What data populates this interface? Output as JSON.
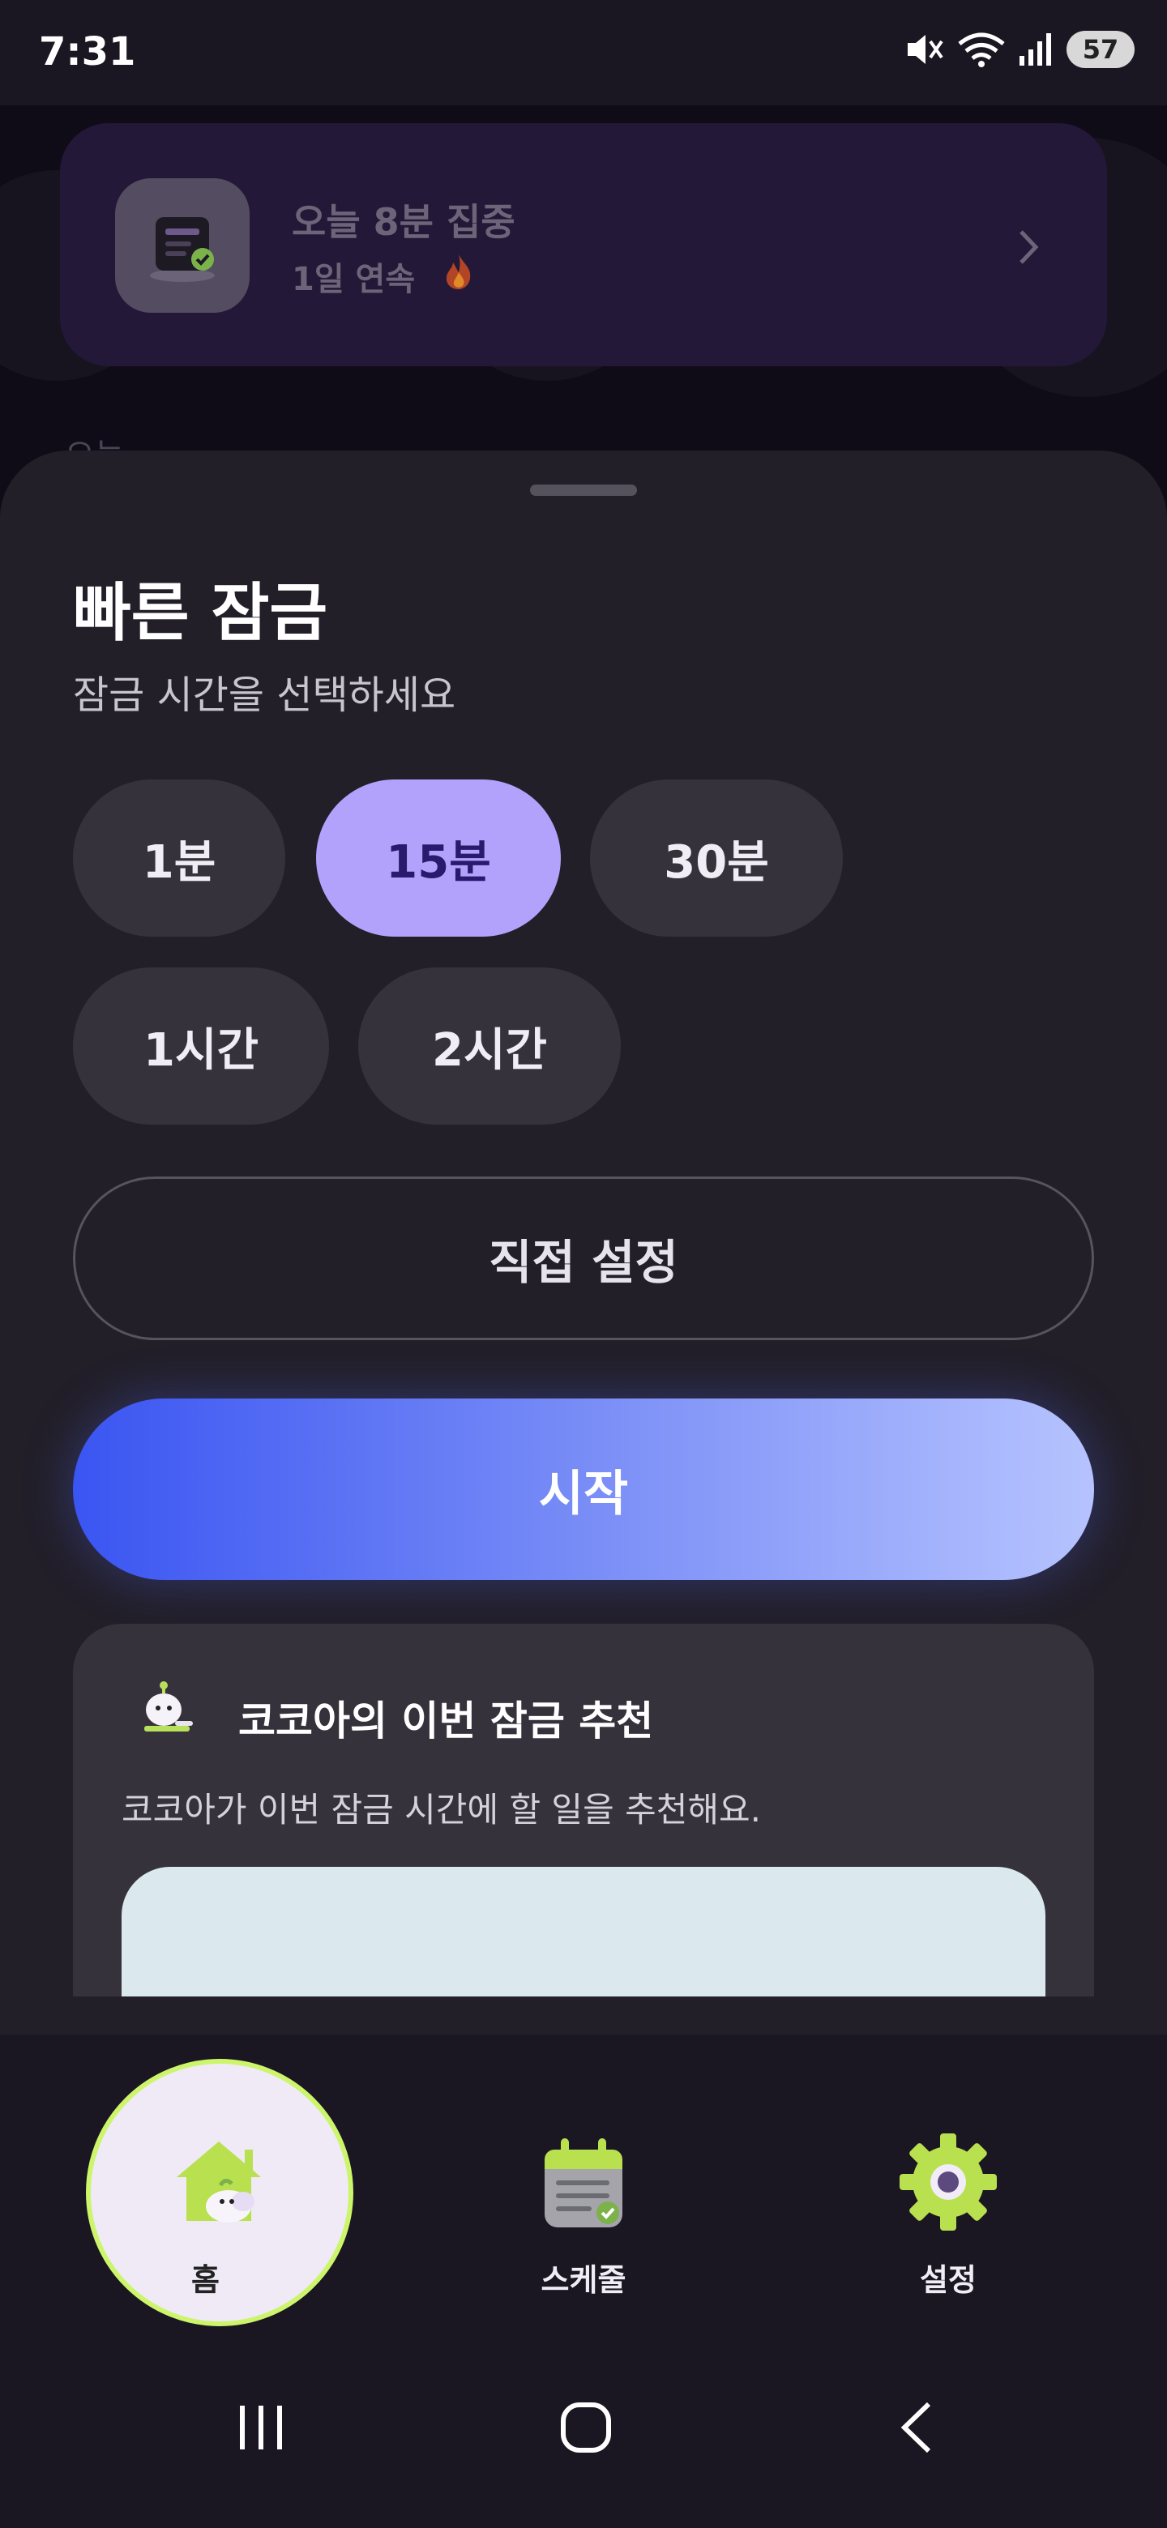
{
  "status_bar": {
    "time": "7:31",
    "battery": "57"
  },
  "background": {
    "focus_title": "오늘 8분 집중",
    "focus_streak": "1일 연속",
    "today_label": "오늘"
  },
  "quick_lock": {
    "title": "빠른 잠금",
    "subtitle": "잠금 시간을 선택하세요",
    "options": [
      {
        "label": "1분",
        "selected": false
      },
      {
        "label": "15분",
        "selected": true
      },
      {
        "label": "30분",
        "selected": false
      },
      {
        "label": "1시간",
        "selected": false
      },
      {
        "label": "2시간",
        "selected": false
      }
    ],
    "custom_label": "직접 설정",
    "start_label": "시작"
  },
  "recommendation": {
    "title": "코코아의 이번 잠금 추천",
    "description": "코코아가 이번 잠금 시간에 할 일을 추천해요."
  },
  "bottom_nav": {
    "items": [
      {
        "label": "홈",
        "icon": "home-icon",
        "active": true
      },
      {
        "label": "스케줄",
        "icon": "calendar-icon",
        "active": false
      },
      {
        "label": "설정",
        "icon": "gear-icon",
        "active": false
      }
    ]
  },
  "colors": {
    "accent_selected": "#b3a2fb",
    "start_gradient_start": "#3a55f2",
    "start_gradient_end": "#b6c3ff",
    "nav_highlight": "#cdf56b"
  }
}
